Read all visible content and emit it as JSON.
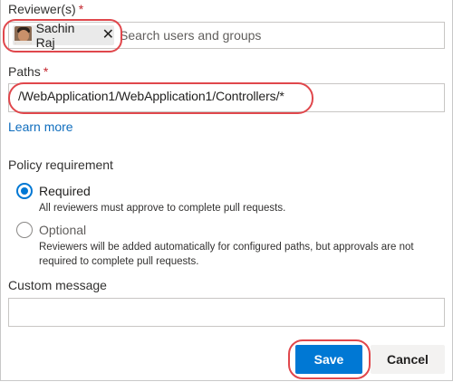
{
  "reviewers": {
    "label": "Reviewer(s)",
    "required_mark": "*",
    "selected": [
      {
        "name": "Sachin Raj"
      }
    ],
    "placeholder": "Search users and groups"
  },
  "paths": {
    "label": "Paths",
    "required_mark": "*",
    "value": "/WebApplication1/WebApplication1/Controllers/*"
  },
  "learn_more": "Learn more",
  "policy": {
    "label": "Policy requirement",
    "options": [
      {
        "label": "Required",
        "description": "All reviewers must approve to complete pull requests.",
        "selected": true
      },
      {
        "label": "Optional",
        "description_line1": "Reviewers will be added automatically for configured paths, but approvals are not",
        "description_line2": "required to complete pull requests.",
        "selected": false
      }
    ]
  },
  "custom_message": {
    "label": "Custom message",
    "value": ""
  },
  "actions": {
    "save": "Save",
    "cancel": "Cancel"
  },
  "colors": {
    "accent": "#0078d4",
    "highlight": "#e0474c",
    "required": "#c4262e"
  }
}
